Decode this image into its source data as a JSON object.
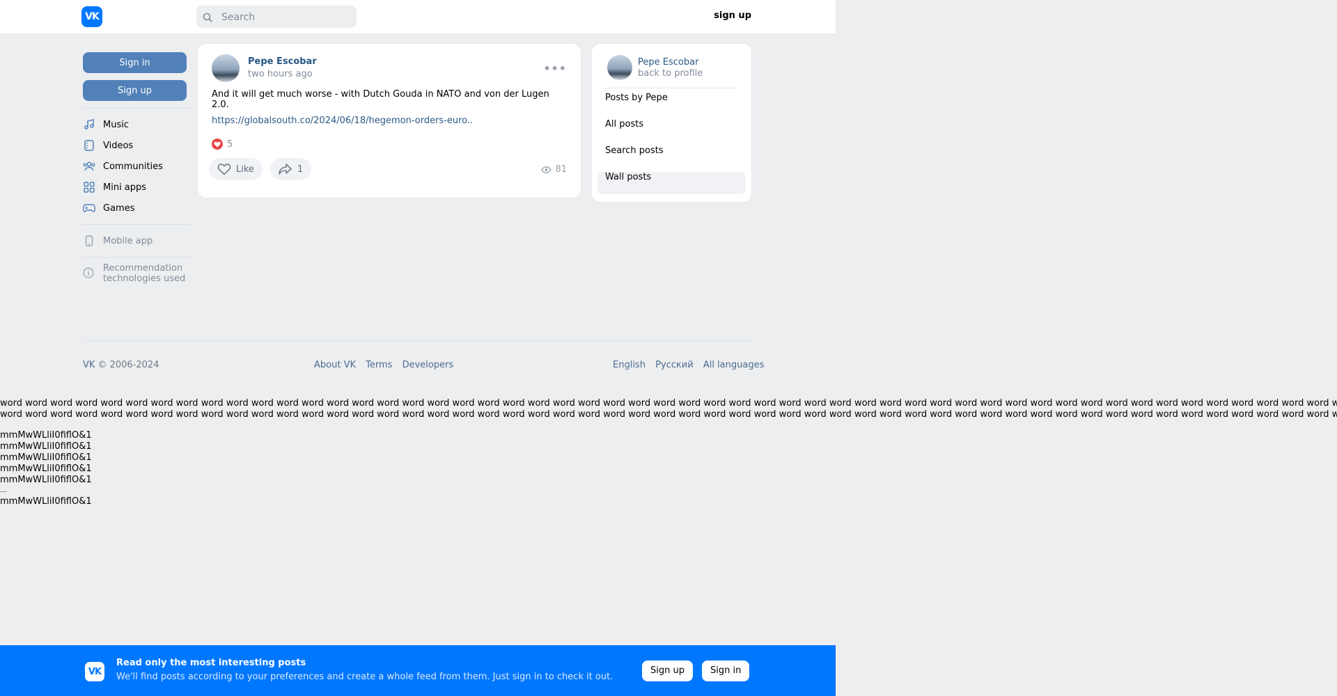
{
  "header": {
    "logo_text": "VK",
    "search_placeholder": "Search",
    "signup_label": "sign up"
  },
  "leftnav": {
    "signin_label": "Sign in",
    "signup_label": "Sign up",
    "items": [
      {
        "label": "Music",
        "icon": "music-icon"
      },
      {
        "label": "Videos",
        "icon": "video-icon"
      },
      {
        "label": "Communities",
        "icon": "communities-icon"
      },
      {
        "label": "Mini apps",
        "icon": "mini-apps-icon"
      },
      {
        "label": "Games",
        "icon": "gamepad-icon"
      }
    ],
    "mobile_app": "Mobile app",
    "recommendation": "Recommendation technologies used"
  },
  "post": {
    "author": "Pepe Escobar",
    "time": "two hours ago",
    "text": "And it will get much worse - with Dutch Gouda in NATO and von der Lugen 2.0.",
    "link": "https://globalsouth.co/2024/06/18/hegemon-orders-euro..",
    "reactions": "5",
    "like_label": "Like",
    "share_count": "1",
    "views": "81"
  },
  "sidebar": {
    "name": "Pepe Escobar",
    "back": "back to profile",
    "items": [
      "Posts by Pepe",
      "All posts",
      "Search posts",
      "Wall posts"
    ],
    "active_index": 3
  },
  "footer": {
    "copyright_brand": "VK",
    "copyright_years": "© 2006-2024",
    "links": [
      "About VK",
      "Terms",
      "Developers"
    ],
    "languages": [
      "English",
      "Русский",
      "All languages"
    ]
  },
  "raw_text": {
    "word_line": "word word word word word word word word word word word word word word word word word word word word word word word word word word word word word word word word word word word word word word word word word word word word word word word word word word word word word word word word word word word word word word word word word word word word word word word word",
    "glyph_line": "mmMwWLliI0fiflO&1"
  },
  "banner": {
    "logo_text": "VK",
    "title": "Read only the most interesting posts",
    "subtitle": "We'll find posts according to your preferences and create a whole feed from them. Just sign in to check it out.",
    "signup_label": "Sign up",
    "signin_label": "Sign in"
  },
  "colors": {
    "brand": "#0077ff",
    "button_blue": "#5181b8",
    "link": "#2a5885",
    "background": "#edeef0"
  }
}
